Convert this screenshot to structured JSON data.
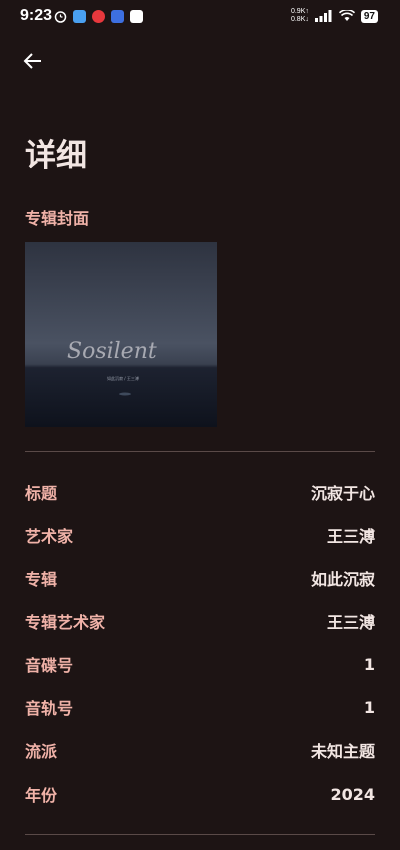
{
  "status_bar": {
    "time": "9:23",
    "net_up": "0.9K↑",
    "net_down": "0.8K↓",
    "battery": "97",
    "icons": [
      "alarm-icon",
      "app-icon",
      "app-icon",
      "app-icon",
      "app-icon",
      "signal-icon",
      "wifi-icon"
    ]
  },
  "header": {
    "back_icon": "arrow-left-icon",
    "title": "详细"
  },
  "cover_section": {
    "label": "专辑封面",
    "cover_text": "Sosilent",
    "cover_subtext": "如此沉寂 / 王三溥"
  },
  "details": [
    {
      "label": "标题",
      "value": "沉寂于心"
    },
    {
      "label": "艺术家",
      "value": "王三溥"
    },
    {
      "label": "专辑",
      "value": "如此沉寂"
    },
    {
      "label": "专辑艺术家",
      "value": "王三溥"
    },
    {
      "label": "音碟号",
      "value": "1"
    },
    {
      "label": "音轨号",
      "value": "1"
    },
    {
      "label": "流派",
      "value": "未知主题"
    },
    {
      "label": "年份",
      "value": "2024"
    }
  ],
  "colors": {
    "background": "#1d1414",
    "accent_label": "#f0b2a8",
    "text": "#f2e6e3"
  }
}
